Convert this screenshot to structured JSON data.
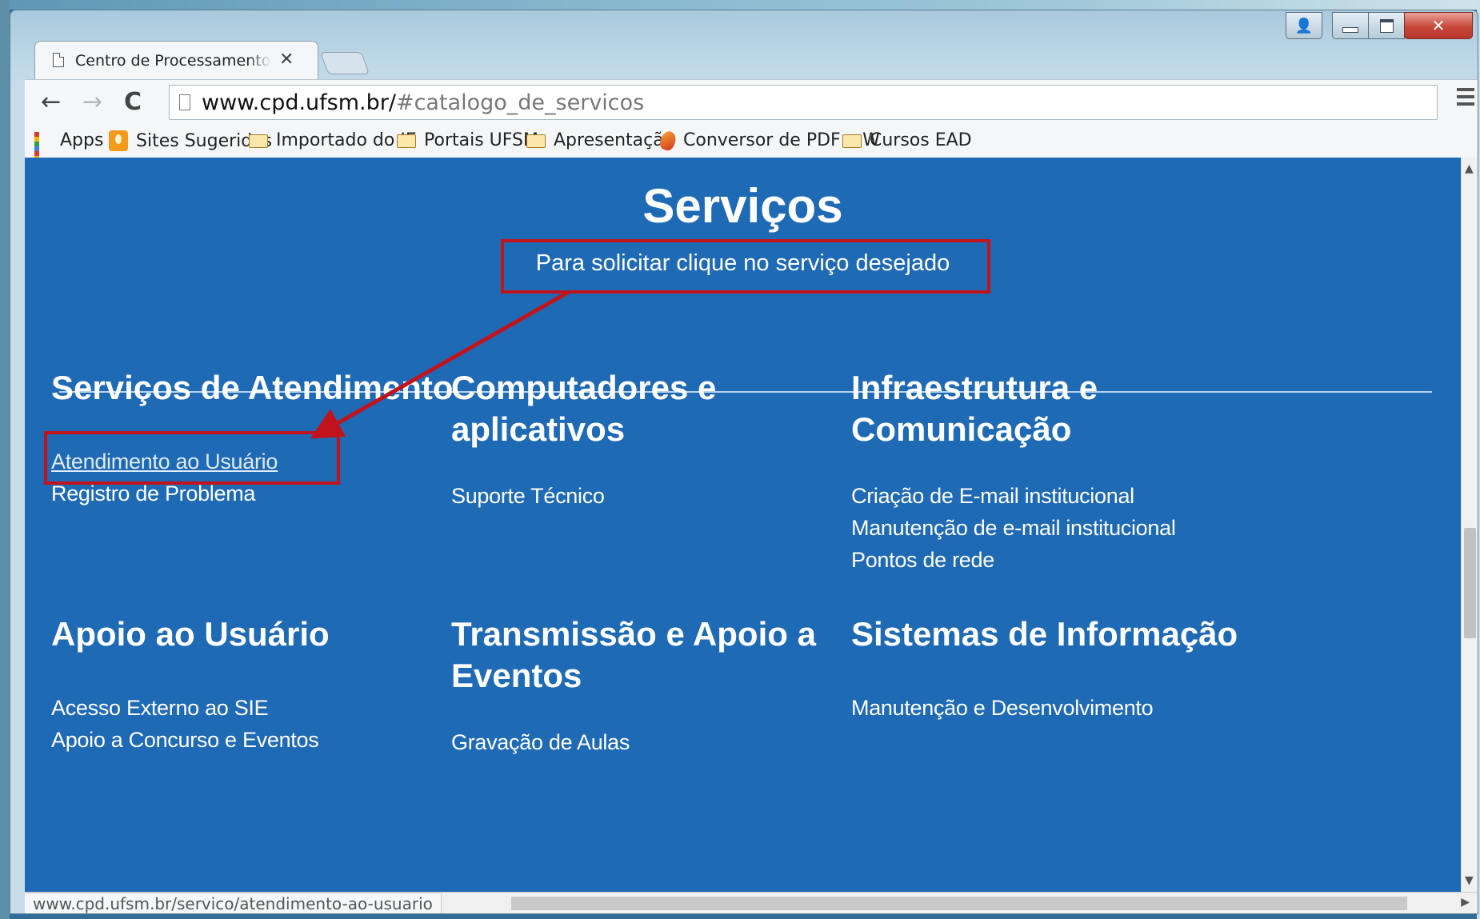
{
  "tab": {
    "title": "Centro de Processamento de Dados",
    "close": "✕"
  },
  "window_controls": {
    "user": "👤",
    "close": "✕"
  },
  "toolbar": {
    "back": "←",
    "forward": "→",
    "reload": "C",
    "url_host": "www.cpd.ufsm.br/",
    "url_fragment": "#catalogo_de_servicos",
    "star": "☆"
  },
  "bookmarks": [
    {
      "label": "Apps",
      "icon": "apps-grid-icon"
    },
    {
      "label": "Sites Sugeridos",
      "icon": "bulb-icon"
    },
    {
      "label": "Importado do IE",
      "icon": "folder-icon"
    },
    {
      "label": "Portais UFSM",
      "icon": "folder-icon"
    },
    {
      "label": "Apresentação",
      "icon": "folder-icon"
    },
    {
      "label": "Conversor de PDF a W",
      "icon": "pdf-converter-icon"
    },
    {
      "label": "Cursos EAD",
      "icon": "folder-icon"
    }
  ],
  "page": {
    "title": "Serviços",
    "subtitle": "Para solicitar clique no serviço desejado",
    "sections": [
      {
        "title": "Serviços de Atendimento",
        "links": [
          "Atendimento ao Usuário",
          "Registro de Problema"
        ]
      },
      {
        "title": "Computadores e aplicativos",
        "links": [
          "Suporte Técnico"
        ]
      },
      {
        "title": "Infraestrutura e Comunicação",
        "links": [
          "Criação de E-mail institucional",
          "Manutenção de e-mail institucional",
          "Pontos de rede"
        ]
      },
      {
        "title": "Apoio ao Usuário",
        "links": [
          "Acesso Externo ao SIE",
          "Apoio a Concurso e Eventos"
        ]
      },
      {
        "title": "Transmissão e Apoio a Eventos",
        "links": [
          "Gravação de Aulas"
        ]
      },
      {
        "title": "Sistemas de Informação",
        "links": [
          "Manutenção e Desenvolvimento"
        ]
      }
    ]
  },
  "status": {
    "url": "www.cpd.ufsm.br/servico/atendimento-ao-usuario"
  },
  "colors": {
    "page_bg": "#1f6ab5",
    "annotation": "#c0131c"
  }
}
